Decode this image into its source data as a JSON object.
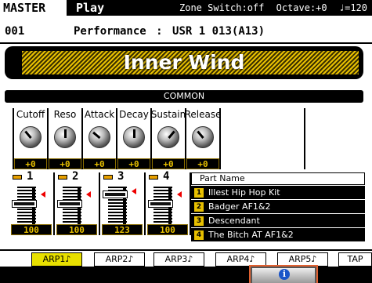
{
  "header": {
    "master_label": "MASTER",
    "mode_label": "Play",
    "zone_switch": "Zone Switch:off",
    "octave": "Octave:+0",
    "tempo": "♩=120"
  },
  "performance": {
    "number": "001",
    "label": "Performance",
    "separator": ":",
    "bank": "USR 1 013(A13)",
    "name": "Inner Wind"
  },
  "common": {
    "label": "COMMON",
    "knobs": [
      {
        "label": "Cutoff",
        "value": "+0"
      },
      {
        "label": "Reso",
        "value": "+0"
      },
      {
        "label": "Attack",
        "value": "+0"
      },
      {
        "label": "Decay",
        "value": "+0"
      },
      {
        "label": "Sustain",
        "value": "+0"
      },
      {
        "label": "Release",
        "value": "+0"
      }
    ]
  },
  "parts": [
    {
      "number": "1",
      "volume": "100"
    },
    {
      "number": "2",
      "volume": "100"
    },
    {
      "number": "3",
      "volume": "123"
    },
    {
      "number": "4",
      "volume": "100"
    }
  ],
  "part_names": {
    "title": "Part Name",
    "items": [
      {
        "index": "1",
        "name": "Illest Hip Hop Kit"
      },
      {
        "index": "2",
        "name": "Badger AF1&2"
      },
      {
        "index": "3",
        "name": "Descendant"
      },
      {
        "index": "4",
        "name": "The Bitch AT AF1&2"
      }
    ]
  },
  "arp_buttons": [
    "ARP1♪",
    "ARP2♪",
    "ARP3♪",
    "ARP4♪",
    "ARP5♪",
    "TAP"
  ],
  "info_button": {
    "icon": "info-icon",
    "glyph": "i"
  },
  "colors": {
    "accent_yellow": "#e8c000",
    "selected_arp": "#e8e000",
    "info_border": "#e06030",
    "info_blue": "#1a55c8"
  }
}
